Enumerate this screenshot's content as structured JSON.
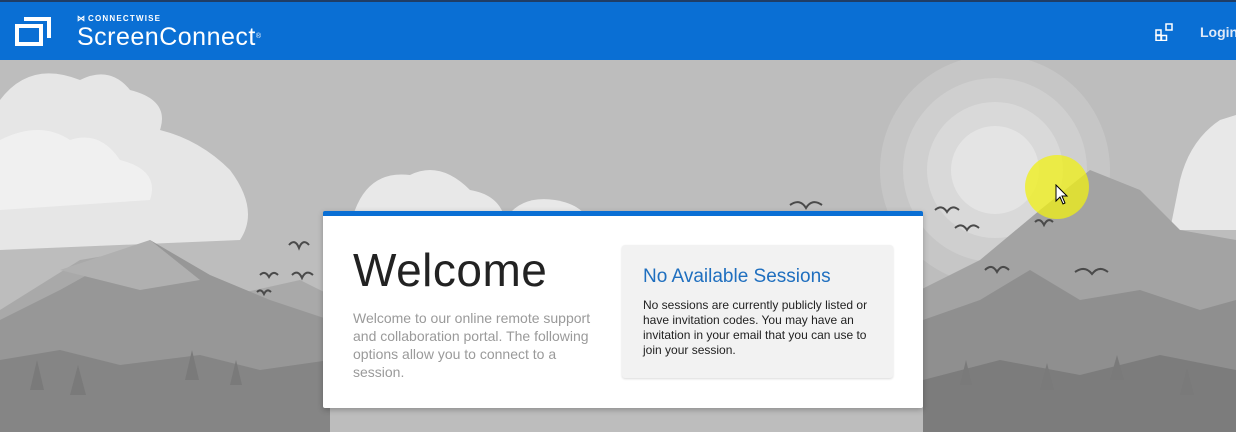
{
  "header": {
    "brand_sup": "CONNECTWISE",
    "brand_name": "ScreenConnect",
    "login_label": "Login",
    "logo_icon": "screenconnect-logo-icon",
    "apps_icon": "app-grid-icon"
  },
  "card": {
    "title": "Welcome",
    "intro": "Welcome to our online remote support and collaboration portal. The following options allow you to connect to a session.",
    "sessions": {
      "title": "No Available Sessions",
      "message": "No sessions are currently publicly listed or have invitation codes. You may have an invitation in your email that you can use to join your session."
    }
  },
  "colors": {
    "header_bg": "#0a6fd4",
    "accent": "#0a6fd4",
    "session_title": "#1f6fbf"
  }
}
